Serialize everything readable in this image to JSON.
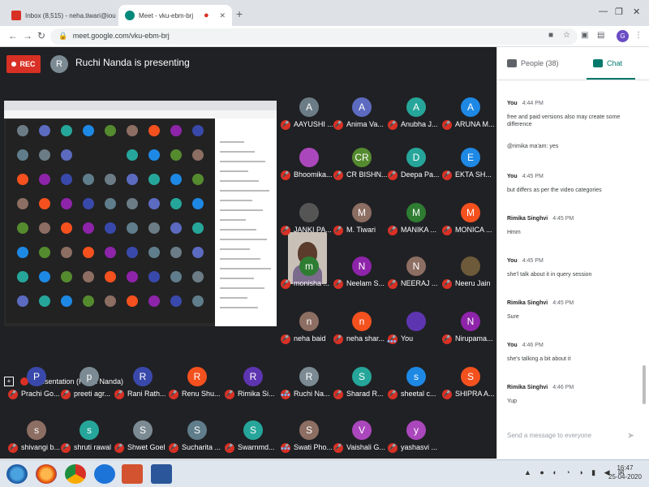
{
  "browser": {
    "tabs": [
      {
        "title": "Inbox (8,515) - neha.tiwari@iou",
        "icon": "gmail-icon",
        "color": "#d93025"
      },
      {
        "title": "Meet - vku-ebm-brj",
        "icon": "meet-icon",
        "color": "#00897b"
      }
    ],
    "url": "meet.google.com/vku-ebm-brj",
    "profile_initial": "G"
  },
  "meet": {
    "rec_label": "REC",
    "presenter_initial": "R",
    "presenter_title": "Ruchi Nanda is presenting",
    "presentation_label": "Presentation (Ruchi Nanda)",
    "participants": [
      {
        "initial": "A",
        "name": "AAYUSHI ...",
        "color": "#6b7c86"
      },
      {
        "initial": "A",
        "name": "Anima Va...",
        "color": "#5c6bc0"
      },
      {
        "initial": "A",
        "name": "Anubha J...",
        "color": "#26a69a"
      },
      {
        "initial": "A",
        "name": "ARUNA M...",
        "color": "#1e88e5"
      },
      {
        "initial": "",
        "name": "Bhoomika...",
        "color": "#ab47bc"
      },
      {
        "initial": "CR",
        "name": "CR BISHN...",
        "color": "#558b2f"
      },
      {
        "initial": "D",
        "name": "Deepa Pa...",
        "color": "#26a69a"
      },
      {
        "initial": "E",
        "name": "EKTA SH...",
        "color": "#1e88e5"
      },
      {
        "initial": "",
        "name": "JANKI PA...",
        "color": "#555555"
      },
      {
        "initial": "M",
        "name": "M. Tiwari",
        "color": "#8d6e63"
      },
      {
        "initial": "M",
        "name": "MANIKA ...",
        "color": "#2e7d32"
      },
      {
        "initial": "M",
        "name": "MONICA ...",
        "color": "#f4511e"
      },
      {
        "initial": "m",
        "name": "monisha ...",
        "color": "#2e7d32"
      },
      {
        "initial": "N",
        "name": "Neelam S...",
        "color": "#8e24aa"
      },
      {
        "initial": "N",
        "name": "NEERAJ ...",
        "color": "#8d6e63"
      },
      {
        "initial": "",
        "name": "Neeru Jain",
        "color": "#6d5a3a"
      },
      {
        "initial": "n",
        "name": "neha baid",
        "color": "#8d6e63"
      },
      {
        "initial": "n",
        "name": "neha shar...",
        "color": "#f4511e"
      },
      {
        "initial": "",
        "name": "You",
        "color": "#5e35b1"
      },
      {
        "initial": "N",
        "name": "Nirupama...",
        "color": "#8e24aa"
      },
      {
        "initial": "P",
        "name": "Prachi Go...",
        "color": "#3949ab"
      },
      {
        "initial": "p",
        "name": "preeti agr...",
        "color": "#7b8a93"
      },
      {
        "initial": "R",
        "name": "Rani Rath...",
        "color": "#3949ab"
      },
      {
        "initial": "R",
        "name": "Renu Shu...",
        "color": "#f4511e"
      },
      {
        "initial": "R",
        "name": "Rimika Si...",
        "color": "#5e35b1"
      },
      {
        "initial": "R",
        "name": "Ruchi Na...",
        "color": "#7b8a93"
      },
      {
        "initial": "S",
        "name": "Sharad R...",
        "color": "#26a69a"
      },
      {
        "initial": "s",
        "name": "sheetal c...",
        "color": "#1e88e5"
      },
      {
        "initial": "S",
        "name": "SHIPRA A...",
        "color": "#f4511e"
      },
      {
        "initial": "s",
        "name": "shivangi b...",
        "color": "#8d6e63"
      },
      {
        "initial": "s",
        "name": "shruti rawal",
        "color": "#26a69a"
      },
      {
        "initial": "S",
        "name": "Shwet Goel",
        "color": "#7b8a93"
      },
      {
        "initial": "S",
        "name": "Sucharita ...",
        "color": "#607d8b"
      },
      {
        "initial": "S",
        "name": "Swarnmd...",
        "color": "#26a69a"
      },
      {
        "initial": "S",
        "name": "Swati Pho...",
        "color": "#8d6e63"
      },
      {
        "initial": "V",
        "name": "Vaishali G...",
        "color": "#ab47bc"
      },
      {
        "initial": "y",
        "name": "yashasvi ...",
        "color": "#ab47bc"
      }
    ]
  },
  "panel": {
    "people_tab": "People (38)",
    "chat_tab": "Chat",
    "messages": [
      {
        "who": "You",
        "time": "4:44 PM",
        "text": "free and paid versions also may create some difference"
      },
      {
        "who": "",
        "time": "",
        "text": "@rimika ma'am: yes"
      },
      {
        "who": "You",
        "time": "4:45 PM",
        "text": "but differs as per the video categories"
      },
      {
        "who": "Rimika Singhvi",
        "time": "4:45 PM",
        "text": "Hmm"
      },
      {
        "who": "You",
        "time": "4:45 PM",
        "text": "she'l talk about it in query session"
      },
      {
        "who": "Rimika Singhvi",
        "time": "4:45 PM",
        "text": "Sure"
      },
      {
        "who": "You",
        "time": "4:46 PM",
        "text": "she's talking a bit about it"
      },
      {
        "who": "Rimika Singhvi",
        "time": "4:46 PM",
        "text": "Yup"
      }
    ],
    "compose_placeholder": "Send a message to everyone"
  },
  "taskbar": {
    "time": "16:47",
    "date": "25-04-2020"
  }
}
